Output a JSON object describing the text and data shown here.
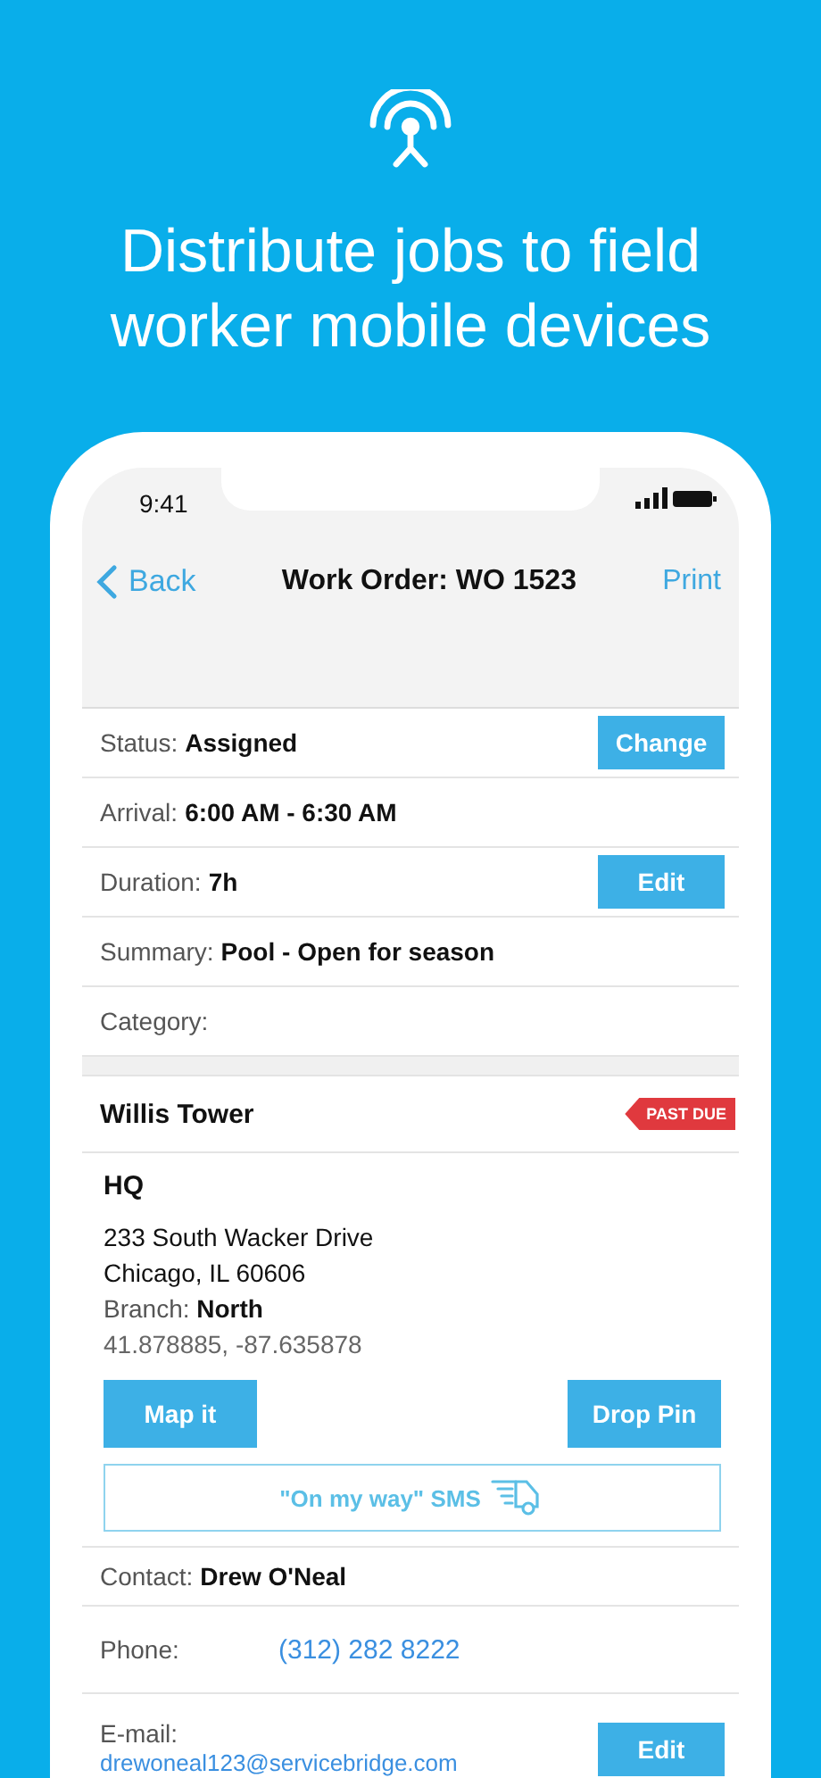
{
  "headline": "Distribute jobs to field worker mobile devices",
  "status_bar": {
    "time": "9:41"
  },
  "nav": {
    "back": "Back",
    "title": "Work Order: WO 1523",
    "action": "Print"
  },
  "details": [
    {
      "label": "Status:",
      "value": "Assigned",
      "button": "Change"
    },
    {
      "label": "Arrival:",
      "value": "6:00 AM - 6:30 AM"
    },
    {
      "label": "Duration:",
      "value": "7h",
      "button": "Edit"
    },
    {
      "label": "Summary:",
      "value": "Pool - Open for season"
    },
    {
      "label": "Category:"
    }
  ],
  "location": {
    "name": "Willis Tower",
    "badge": "PAST DUE",
    "site": "HQ",
    "address": [
      "233 South Wacker Drive",
      "Chicago, IL 60606"
    ],
    "branch_label": "Branch:",
    "branch": "North",
    "coordinates": "41.878885, -87.635878",
    "buttons": [
      "Map it",
      "Drop Pin"
    ],
    "sms_button": "\"On my way\" SMS"
  },
  "contact": [
    {
      "kind": "inline",
      "label": "Contact:",
      "value": "Drew O'Neal"
    },
    {
      "kind": "link",
      "label": "Phone:",
      "value": "(312) 282 8222"
    },
    {
      "kind": "stacked",
      "label": "E-mail:",
      "value": "drewoneal123@servicebridge.com",
      "button": "Edit"
    }
  ]
}
